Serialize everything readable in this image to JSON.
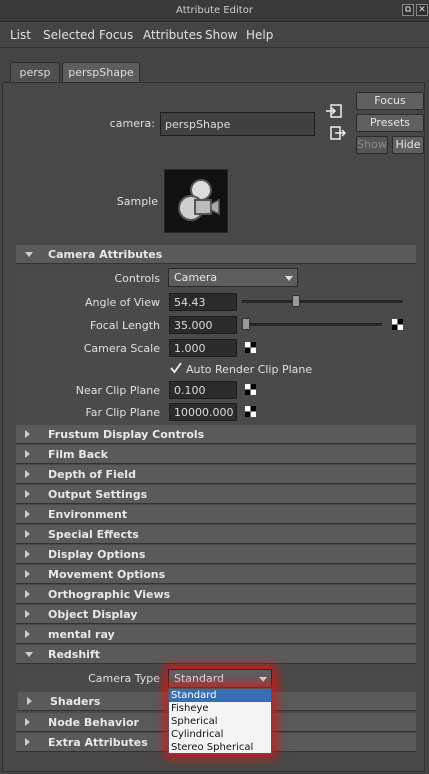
{
  "window": {
    "title": "Attribute Editor",
    "btn_restore": "⧉",
    "btn_close": "✕"
  },
  "menu": [
    "List",
    "Selected",
    "Focus",
    "Attributes",
    "Show",
    "Help"
  ],
  "tabs": [
    "persp",
    "perspShape"
  ],
  "node": {
    "label": "camera:",
    "value": "perspShape"
  },
  "side_buttons": {
    "focus": "Focus",
    "presets": "Presets",
    "show": "Show",
    "hide": "Hide"
  },
  "sample": {
    "label": "Sample"
  },
  "camera_attributes": {
    "title": "Camera Attributes",
    "controls_label": "Controls",
    "controls_value": "Camera",
    "angle_label": "Angle of View",
    "angle_value": "54.43",
    "angle_slider_fraction": 0.33,
    "focal_label": "Focal Length",
    "focal_value": "35.000",
    "focal_slider_fraction": 0.0,
    "scale_label": "Camera Scale",
    "scale_value": "1.000",
    "auto_clip_label": "Auto Render Clip Plane",
    "auto_clip_checked": true,
    "near_label": "Near Clip Plane",
    "near_value": "0.100",
    "far_label": "Far Clip Plane",
    "far_value": "10000.000"
  },
  "sections": [
    "Frustum Display Controls",
    "Film Back",
    "Depth of Field",
    "Output Settings",
    "Environment",
    "Special Effects",
    "Display Options",
    "Movement Options",
    "Orthographic Views",
    "Object Display",
    "mental ray"
  ],
  "redshift": {
    "title": "Redshift",
    "camera_type_label": "Camera Type",
    "camera_type_value": "Standard",
    "shaders": "Shaders",
    "options": [
      "Standard",
      "Fisheye",
      "Spherical",
      "Cylindrical",
      "Stereo Spherical"
    ]
  },
  "bottom_sections": [
    "Node Behavior",
    "Extra Attributes"
  ],
  "colors": {
    "highlight": "#3b6db3",
    "glow": "#dc1414"
  }
}
